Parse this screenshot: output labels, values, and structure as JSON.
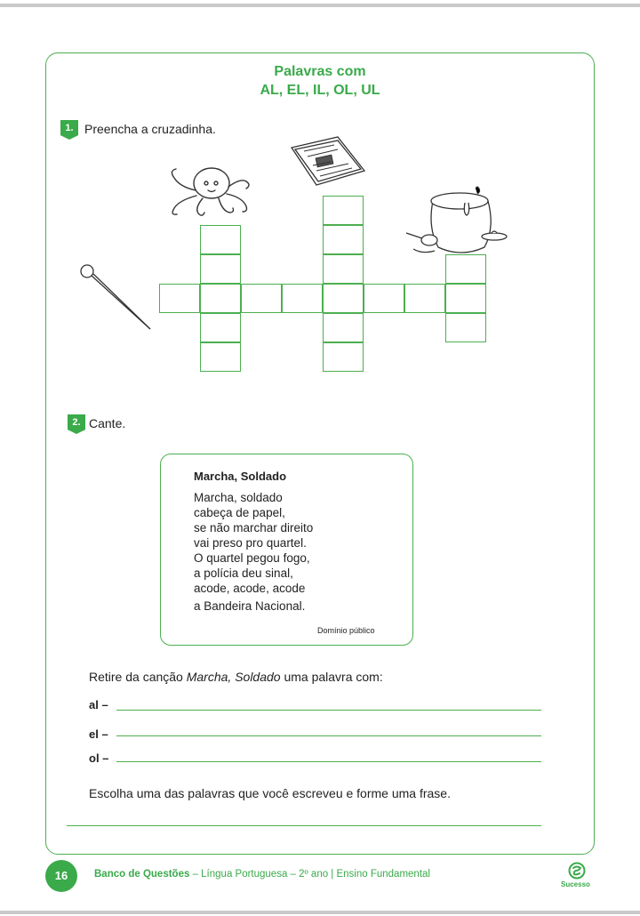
{
  "header": {
    "title_line1": "Palavras com",
    "title_line2": "AL, EL, IL, OL, UL"
  },
  "questions": [
    {
      "number": "1.",
      "instruction": "Preencha a cruzadinha."
    },
    {
      "number": "2.",
      "instruction": "Cante."
    }
  ],
  "crossword": {
    "pictures": [
      "octopus-icon",
      "newspaper-icon",
      "pin-icon",
      "honey-pot-icon"
    ]
  },
  "song": {
    "title": "Marcha, Soldado",
    "lines": [
      "Marcha, soldado",
      "cabeça de papel,",
      "se não marchar direito",
      "vai preso pro quartel.",
      "O quartel pegou fogo,",
      "a polícia deu sinal,",
      "acode, acode, acode",
      "a Bandeira Nacional."
    ],
    "source": "Domínio público"
  },
  "exercise": {
    "prompt_before": "Retire da canção ",
    "prompt_italic": "Marcha, Soldado",
    "prompt_after": " uma palavra com:",
    "labels": [
      "al –",
      "el –",
      "ol –"
    ],
    "final_prompt": "Escolha uma das palavras que você escreveu e forme uma frase."
  },
  "footer": {
    "page_number": "16",
    "book_title": "Banco de Questões",
    "details": " – Língua Portuguesa – 2º ano | Ensino Fundamental",
    "brand": "Sucesso"
  },
  "colors": {
    "accent": "#3aaa4a",
    "rule": "#c9c9c9"
  }
}
